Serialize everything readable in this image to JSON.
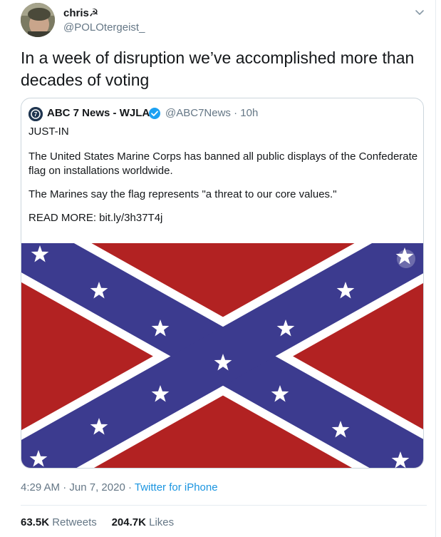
{
  "author": {
    "name": "chris",
    "name_glyph": "☭",
    "handle": "@POLOtergeist_"
  },
  "tweet": {
    "text": "In a week of disruption we’ve accomplished more than decades of voting"
  },
  "quote": {
    "name": "ABC 7 News - WJLA",
    "handle": "@ABC7News",
    "separator": " · ",
    "time": "10h",
    "lines": [
      "JUST-IN",
      "The United States Marine Corps has banned all public displays of the Confederate flag on installations worldwide.",
      "The Marines say the flag represents \"a threat to our core values.\"",
      "READ MORE: bit.ly/3h37T4j"
    ]
  },
  "meta": {
    "time": "4:29 AM",
    "date": "Jun 7, 2020",
    "sep": " · ",
    "source": "Twitter for iPhone"
  },
  "stats": {
    "retweets_count": "63.5K",
    "retweets_label": "Retweets",
    "likes_count": "204.7K",
    "likes_label": "Likes"
  },
  "colors": {
    "link": "#1b95e0",
    "secondary_text": "#657786",
    "flag_red": "#b22222",
    "flag_blue": "#3c3b8f",
    "verified": "#1da1f2"
  },
  "icons": {
    "caret": "chevron-down-icon",
    "verified": "verified-badge-icon"
  }
}
